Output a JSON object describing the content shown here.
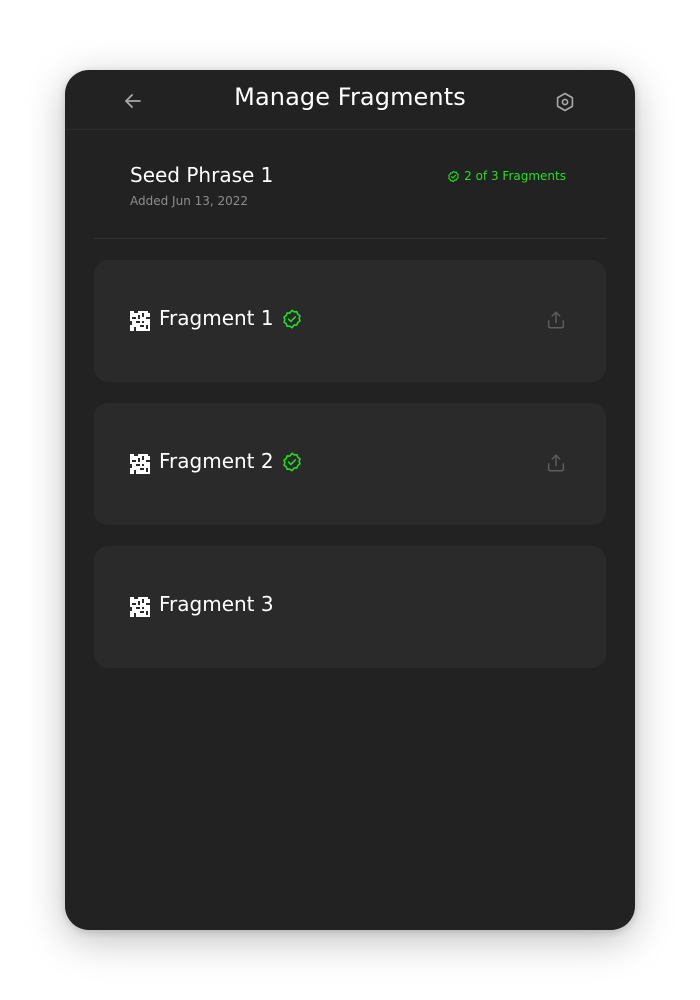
{
  "header": {
    "title": "Manage Fragments",
    "back_icon": "arrow-left-icon",
    "settings_icon": "hexagon-gear-icon"
  },
  "seed": {
    "title": "Seed Phrase 1",
    "added": "Added Jun 13, 2022",
    "status": "2 of 3 Fragments",
    "status_icon": "verified-badge-icon"
  },
  "fragments": [
    {
      "label": "Fragment 1",
      "verified": true,
      "shareable": true
    },
    {
      "label": "Fragment 2",
      "verified": true,
      "shareable": true
    },
    {
      "label": "Fragment 3",
      "verified": false,
      "shareable": false
    }
  ],
  "colors": {
    "background": "#222222",
    "card": "#2a2a2a",
    "accent": "#21e21f",
    "muted": "#8d8d8d",
    "icon": "#9a9a9a"
  }
}
